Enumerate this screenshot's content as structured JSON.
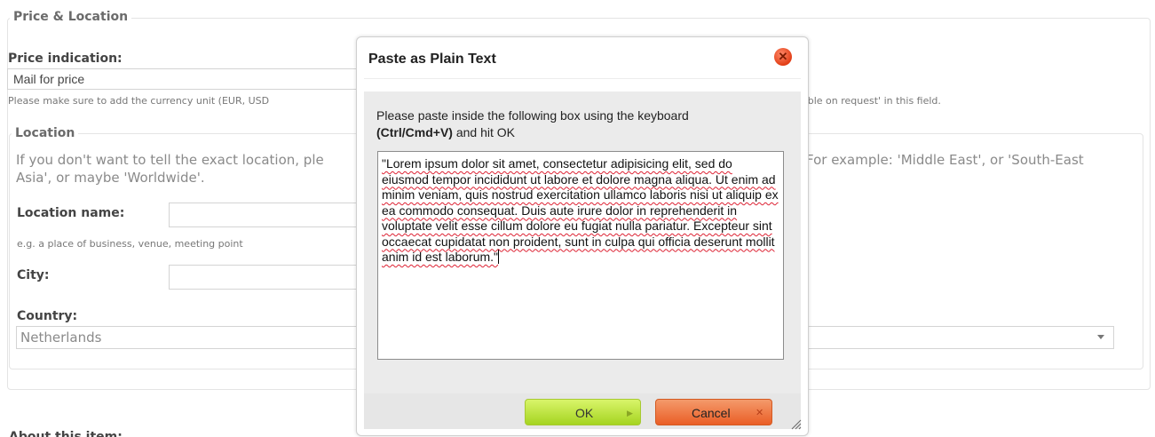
{
  "form": {
    "section_title": "Price & Location",
    "price_label": "Price indication:",
    "price_value": "Mail for price",
    "price_help_left": "Please make sure to add the currency unit (EUR, USD",
    "price_help_right": "able on request' in this field.",
    "location_legend": "Location",
    "location_desc_left_1": "If you don't want to tell the exact location, ple",
    "location_desc_left_2": "Asia', or maybe 'Worldwide'.",
    "location_desc_right": "For example: 'Middle East', or 'South-East",
    "location_name_label": "Location name:",
    "location_name_help": "e.g. a place of business, venue, meeting point",
    "city_label": "City:",
    "country_label": "Country:",
    "country_value": "Netherlands",
    "about_label": "About this item:"
  },
  "dialog": {
    "title": "Paste as Plain Text",
    "close_icon": "close-icon",
    "instruction_line1": "Please paste inside the following box using the keyboard",
    "instruction_shortcut": "(Ctrl/Cmd+V)",
    "instruction_rest": " and hit OK",
    "textarea_value": "\"Lorem ipsum dolor sit amet, consectetur adipisicing elit, sed do eiusmod tempor incididunt ut labore et dolore magna aliqua. Ut enim ad minim veniam, quis nostrud exercitation ullamco laboris nisi ut aliquip ex ea commodo consequat. Duis aute irure dolor in reprehenderit in voluptate velit esse cillum dolore eu fugiat nulla pariatur. Excepteur sint occaecat cupidatat non proident, sunt in culpa qui officia deserunt mollit anim id est laborum.\"",
    "ok_label": "OK",
    "cancel_label": "Cancel",
    "ok_color": "#a5d421",
    "cancel_color": "#ea5e26"
  }
}
